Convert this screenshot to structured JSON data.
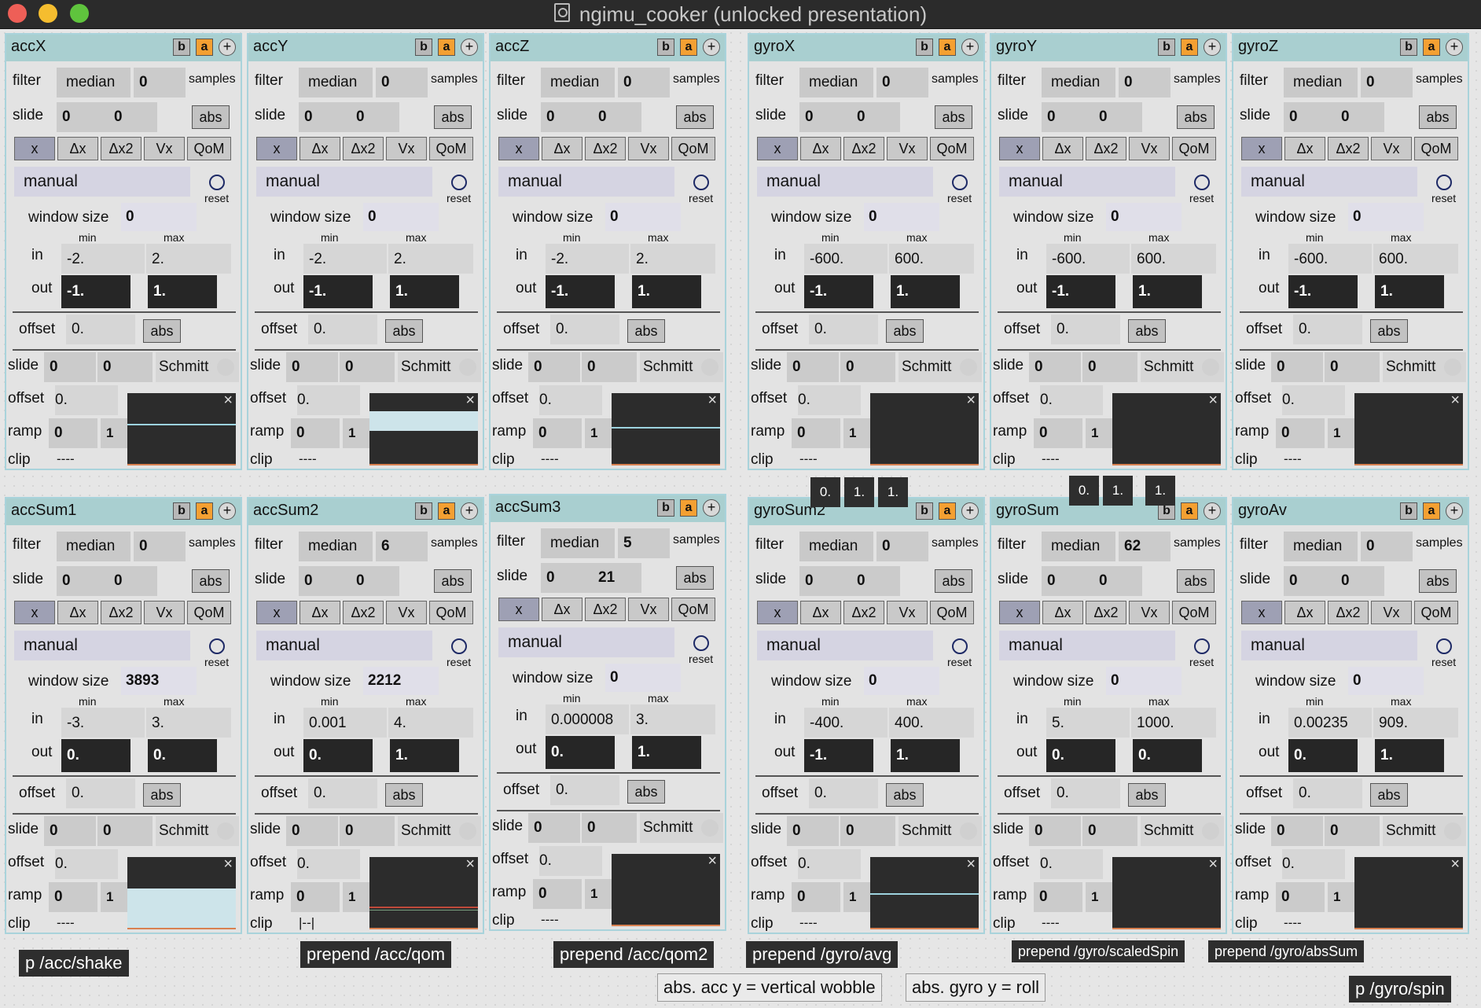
{
  "window": {
    "title": "ngimu_cooker (unlocked presentation)"
  },
  "labels": {
    "filter": "filter",
    "samples": "samples",
    "slide": "slide",
    "abs": "abs",
    "manual": "manual",
    "reset": "reset",
    "window_size": "window size",
    "min": "min",
    "max": "max",
    "in": "in",
    "out": "out",
    "offset": "offset",
    "schmitt": "Schmitt",
    "ramp": "ramp",
    "clip": "clip",
    "modes": [
      "x",
      "Δx",
      "Δx2",
      "Vx",
      "QoM"
    ],
    "b": "b",
    "a": "a",
    "plus": "+"
  },
  "panels": [
    {
      "title": "accX",
      "filter_type": "median",
      "samples": "0",
      "slide_a": "0",
      "slide_b": "0",
      "window_size": "0",
      "window_bold": false,
      "in_min": "-2.",
      "in_max": "2.",
      "out_min": "-1.",
      "out_max": "1.",
      "offset1": "0.",
      "slide2_a": "0",
      "slide2_b": "0",
      "offset2": "0.",
      "ramp_a": "0",
      "ramp_b": "1",
      "clip": "----",
      "scope": {
        "fill_level": 0,
        "line_level": 0.42
      }
    },
    {
      "title": "accY",
      "filter_type": "median",
      "samples": "0",
      "slide_a": "0",
      "slide_b": "0",
      "window_size": "0",
      "window_bold": false,
      "in_min": "-2.",
      "in_max": "2.",
      "out_min": "-1.",
      "out_max": "1.",
      "offset1": "0.",
      "slide2_a": "0",
      "slide2_b": "0",
      "offset2": "0.",
      "ramp_a": "0",
      "ramp_b": "1",
      "clip": "----",
      "scope": {
        "fill_level": 0.27,
        "fill_top": 0.25,
        "line_level": 0
      }
    },
    {
      "title": "accZ",
      "filter_type": "median",
      "samples": "0",
      "slide_a": "0",
      "slide_b": "0",
      "window_size": "0",
      "window_bold": false,
      "in_min": "-2.",
      "in_max": "2.",
      "out_min": "-1.",
      "out_max": "1.",
      "offset1": "0.",
      "slide2_a": "0",
      "slide2_b": "0",
      "offset2": "0.",
      "ramp_a": "0",
      "ramp_b": "1",
      "clip": "----",
      "scope": {
        "fill_level": 0,
        "line_level": 0.47
      }
    },
    {
      "title": "gyroX",
      "filter_type": "median",
      "samples": "0",
      "slide_a": "0",
      "slide_b": "0",
      "window_size": "0",
      "window_bold": false,
      "in_min": "-600.",
      "in_max": "600.",
      "out_min": "-1.",
      "out_max": "1.",
      "offset1": "0.",
      "slide2_a": "0",
      "slide2_b": "0",
      "offset2": "0.",
      "ramp_a": "0",
      "ramp_b": "1",
      "clip": "----",
      "scope": {
        "fill_level": 0,
        "line_level": 0
      }
    },
    {
      "title": "gyroY",
      "filter_type": "median",
      "samples": "0",
      "slide_a": "0",
      "slide_b": "0",
      "window_size": "0",
      "window_bold": false,
      "in_min": "-600.",
      "in_max": "600.",
      "out_min": "-1.",
      "out_max": "1.",
      "offset1": "0.",
      "slide2_a": "0",
      "slide2_b": "0",
      "offset2": "0.",
      "ramp_a": "0",
      "ramp_b": "1",
      "clip": "----",
      "scope": {
        "fill_level": 0,
        "line_level": 0
      }
    },
    {
      "title": "gyroZ",
      "filter_type": "median",
      "samples": "0",
      "slide_a": "0",
      "slide_b": "0",
      "window_size": "0",
      "window_bold": false,
      "in_min": "-600.",
      "in_max": "600.",
      "out_min": "-1.",
      "out_max": "1.",
      "offset1": "0.",
      "slide2_a": "0",
      "slide2_b": "0",
      "offset2": "0.",
      "ramp_a": "0",
      "ramp_b": "1",
      "clip": "----",
      "scope": {
        "fill_level": 0,
        "line_level": 0
      }
    },
    {
      "title": "accSum1",
      "filter_type": "median",
      "samples": "0",
      "slide_a": "0",
      "slide_b": "0",
      "window_size": "3893",
      "window_bold": true,
      "in_min": "-3.",
      "in_max": "3.",
      "out_min": "0.",
      "out_max": "0.",
      "offset1": "0.",
      "slide2_a": "0",
      "slide2_b": "0",
      "offset2": "0.",
      "ramp_a": "0",
      "ramp_b": "1",
      "clip": "----",
      "scope": {
        "fill_level": 0.57,
        "line_level": 0
      }
    },
    {
      "title": "accSum2",
      "filter_type": "median",
      "samples": "6",
      "slide_a": "0",
      "slide_b": "0",
      "window_size": "2212",
      "window_bold": true,
      "in_min": "0.001",
      "in_max": "4.",
      "out_min": "0.",
      "out_max": "1.",
      "offset1": "0.",
      "slide2_a": "0",
      "slide2_b": "0",
      "offset2": "0.",
      "ramp_a": "0",
      "ramp_b": "1",
      "clip": "|--|",
      "scope": {
        "fill_level": 0,
        "line_level": 0,
        "red_line": true
      }
    },
    {
      "title": "accSum3",
      "filter_type": "median",
      "samples": "5",
      "slide_a": "0",
      "slide_b": "21",
      "window_size": "0",
      "window_bold": false,
      "in_min": "0.000008",
      "in_max": "3.",
      "out_min": "0.",
      "out_max": "1.",
      "offset1": "0.",
      "slide2_a": "0",
      "slide2_b": "0",
      "offset2": "0.",
      "ramp_a": "0",
      "ramp_b": "1",
      "clip": "----",
      "scope": {
        "fill_level": 0,
        "line_level": 0
      }
    },
    {
      "title": "gyroSum2",
      "filter_type": "median",
      "samples": "0",
      "slide_a": "0",
      "slide_b": "0",
      "window_size": "0",
      "window_bold": false,
      "in_min": "-400.",
      "in_max": "400.",
      "out_min": "-1.",
      "out_max": "1.",
      "offset1": "0.",
      "slide2_a": "0",
      "slide2_b": "0",
      "offset2": "0.",
      "ramp_a": "0",
      "ramp_b": "1",
      "clip": "----",
      "scope": {
        "fill_level": 0,
        "line_level": 0.5
      }
    },
    {
      "title": "gyroSum",
      "filter_type": "median",
      "samples": "62",
      "slide_a": "0",
      "slide_b": "0",
      "window_size": "0",
      "window_bold": false,
      "in_min": "5.",
      "in_max": "1000.",
      "out_min": "0.",
      "out_max": "0.",
      "offset1": "0.",
      "slide2_a": "0",
      "slide2_b": "0",
      "offset2": "0.",
      "ramp_a": "0",
      "ramp_b": "1",
      "clip": "----",
      "scope": {
        "fill_level": 0,
        "line_level": 0
      }
    },
    {
      "title": "gyroAv",
      "filter_type": "median",
      "samples": "0",
      "slide_a": "0",
      "slide_b": "0",
      "window_size": "0",
      "window_bold": false,
      "in_min": "0.00235",
      "in_max": "909.",
      "out_min": "0.",
      "out_max": "1.",
      "offset1": "0.",
      "slide2_a": "0",
      "slide2_b": "0",
      "offset2": "0.",
      "ramp_a": "0",
      "ramp_b": "1",
      "clip": "----",
      "scope": {
        "fill_level": 0,
        "line_level": 0
      }
    }
  ],
  "value_boxes": [
    [
      "0.",
      "1.",
      "1."
    ],
    [
      "0.",
      "1.",
      "1."
    ]
  ],
  "messages": {
    "acc_shake": "p /acc/shake",
    "acc_qom": "prepend /acc/qom",
    "acc_qom2": "prepend /acc/qom2",
    "gyro_avg": "prepend /gyro/avg",
    "gyro_scaledspin": "prepend /gyro/scaledSpin",
    "gyro_abssum": "prepend /gyro/absSum",
    "gyro_spin": "p /gyro/spin"
  },
  "notes": {
    "acc_y": "abs. acc y = vertical wobble",
    "gyro_y": "abs. gyro y = roll"
  },
  "colors": {
    "panel_header": "#a9cfd0",
    "panel_border": "#a9d3db",
    "a_button": "#f4a032",
    "mode_active": "#9ea0b4",
    "manual_bg": "#d5d4e2",
    "reset_ring": "#1e2a66"
  }
}
